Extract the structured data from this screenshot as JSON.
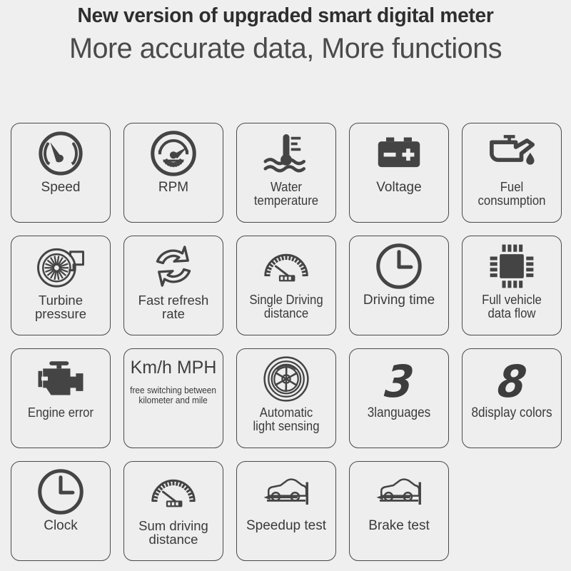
{
  "header": {
    "title": "New version of upgraded smart digital meter",
    "subtitle": "More accurate data,  More functions"
  },
  "features": [
    {
      "label": "Speed",
      "icon": "speedometer-icon"
    },
    {
      "label": "RPM",
      "icon": "tachometer-icon"
    },
    {
      "label": "Water\ntemperature",
      "icon": "water-temperature-icon"
    },
    {
      "label": "Voltage",
      "icon": "battery-icon"
    },
    {
      "label": "Fuel\nconsumption",
      "icon": "oil-can-icon"
    },
    {
      "label": "Turbine\npressure",
      "icon": "turbocharger-icon"
    },
    {
      "label": "Fast refresh\nrate",
      "icon": "refresh-arrows-icon"
    },
    {
      "label": "Single Driving\ndistance",
      "icon": "odometer-gauge-icon"
    },
    {
      "label": "Driving time",
      "icon": "clock-icon"
    },
    {
      "label": "Full vehicle\ndata flow",
      "icon": "microchip-icon"
    },
    {
      "label": "Engine error",
      "icon": "engine-icon"
    },
    {
      "label": "",
      "icon": "unit-text",
      "unit_main": "Km/h\nMPH",
      "unit_sub": "free switching between\nkilometer and mile"
    },
    {
      "label": "Automatic\nlight sensing",
      "icon": "light-sensor-aperture-icon"
    },
    {
      "label": "3languages",
      "icon": "digit-3",
      "digit": "3"
    },
    {
      "label": "8display colors",
      "icon": "digit-8",
      "digit": "8"
    },
    {
      "label": "Clock",
      "icon": "clock-icon"
    },
    {
      "label": "Sum driving\ndistance",
      "icon": "odometer-gauge-icon"
    },
    {
      "label": "Speedup test",
      "icon": "car-accel-icon"
    },
    {
      "label": "Brake test",
      "icon": "car-brake-icon"
    }
  ],
  "colors": {
    "background": "#efefef",
    "tile_fill": "#eeeeee",
    "tile_border": "#4a4a4a",
    "icon": "#444444",
    "text": "#3a3a3a",
    "title": "#2e2e2e"
  }
}
